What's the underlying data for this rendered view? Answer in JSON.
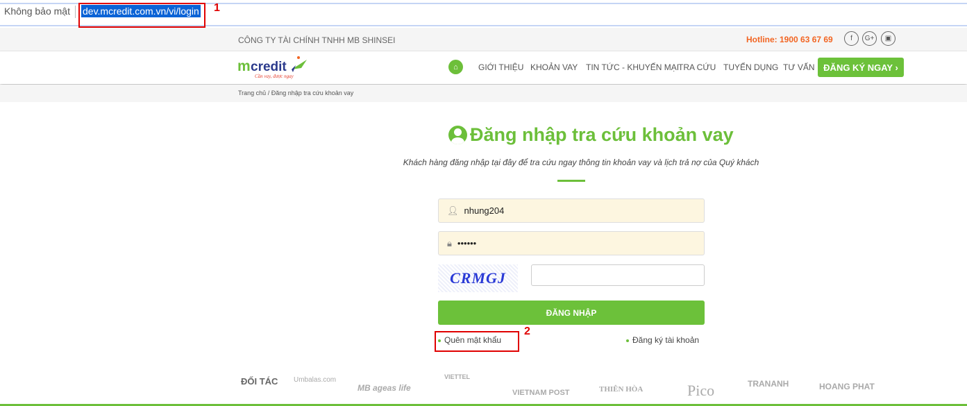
{
  "browser": {
    "security": "Không bảo mật",
    "url": "dev.mcredit.com.vn/vi/login"
  },
  "annotations": [
    "1",
    "2"
  ],
  "topbar": {
    "company": "CÔNG TY TÀI CHÍNH TNHH MB SHINSEI",
    "hotline": "Hotline: 1900 63 67 69",
    "social": [
      "facebook-icon",
      "google-plus-icon",
      "youtube-icon"
    ]
  },
  "logo": {
    "text": "mcredit",
    "slogan": "Cần vay, được ngay"
  },
  "nav": {
    "items": [
      "GIỚI THIỆU",
      "KHOẢN VAY",
      "TIN TỨC - KHUYẾN MẠI",
      "TRA CỨU",
      "TUYỂN DỤNG",
      "TƯ VẤN"
    ],
    "register": "ĐĂNG KÝ NGAY ›"
  },
  "breadcrumb": "Trang chủ / Đăng nhập tra cứu khoản vay",
  "login": {
    "title": "Đăng nhập tra cứu khoản vay",
    "subtitle": "Khách hàng đăng nhập tại đây để tra cứu ngay thông tin khoản vay và lịch trả nợ của Quý khách",
    "username": "nhung204",
    "password": "••••••",
    "captcha": "CRMGJ",
    "captcha_input": "",
    "submit": "ĐĂNG NHẬP",
    "forgot": "Quên mật khẩu",
    "signup": "Đăng ký tài khoản"
  },
  "partners": {
    "label": "ĐỐI TÁC",
    "logos": [
      "Umbalas.com",
      "MB ageas life",
      "VIETTEL",
      "VIETNAM POST",
      "THIÊN HÒA",
      "Pico",
      "TRANANH",
      "HOANG PHAT"
    ]
  },
  "colors": {
    "brand_green": "#6cc13a",
    "hotline_orange": "#f26522",
    "input_bg": "#fdf6e0"
  }
}
